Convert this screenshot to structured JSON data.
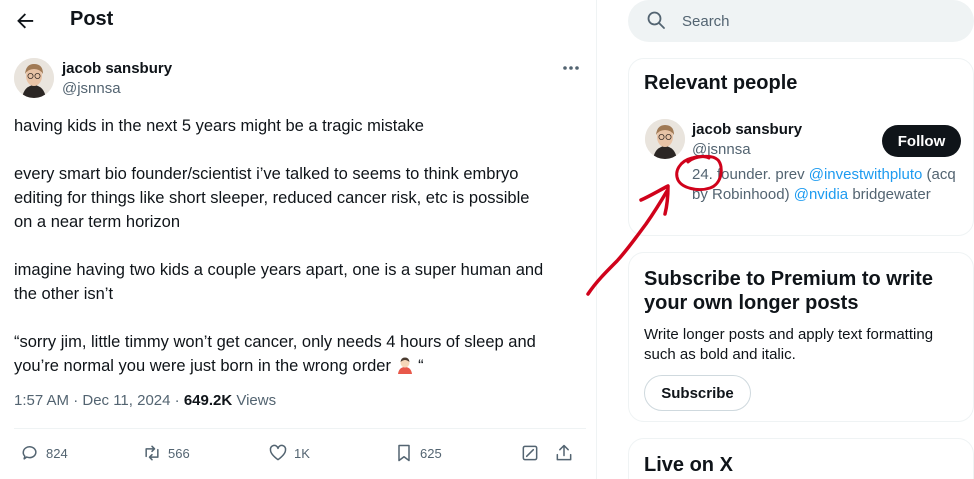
{
  "header": {
    "title": "Post"
  },
  "tweet": {
    "author_name": "jacob sansbury",
    "author_handle": "@jsnnsa",
    "paragraphs": [
      "having kids in the next 5 years might be a tragic mistake",
      "every smart bio founder/scientist i’ve talked to seems to think embryo\nediting for things like short sleeper, reduced cancer risk, etc is possible\non a near term horizon",
      "imagine having two kids a couple years apart, one is a super human and\nthe other isn’t",
      "“sorry jim, little timmy won’t get cancer, only needs 4 hours of sleep and\nyou’re normal you were just born in the wrong order",
      "“"
    ],
    "timestamp": "1:57 AM · Dec 11, 2024 · ",
    "views_count": "649.2K",
    "views_label": " Views",
    "actions": {
      "replies": "824",
      "reposts": "566",
      "likes": "1K",
      "bookmarks": "625"
    }
  },
  "search": {
    "placeholder": "Search"
  },
  "relevant_people": {
    "title": "Relevant people",
    "name": "jacob sansbury",
    "handle": "@jsnnsa",
    "bio_prefix": "24. founder. prev ",
    "bio_link1": "@investwithpluto",
    "bio_middle": " (acq by Robinhood) ",
    "bio_link2": "@nvidia",
    "bio_suffix": " bridgewater",
    "follow_label": "Follow"
  },
  "premium": {
    "title": "Subscribe to Premium to write your own longer posts",
    "body": "Write longer posts and apply text formatting such as bold and italic.",
    "button_label": "Subscribe"
  },
  "live": {
    "title": "Live on X"
  },
  "colors": {
    "accent": "#1d9bf0",
    "annotation": "#d0021b",
    "text_primary": "#0f1419",
    "text_secondary": "#536471"
  }
}
